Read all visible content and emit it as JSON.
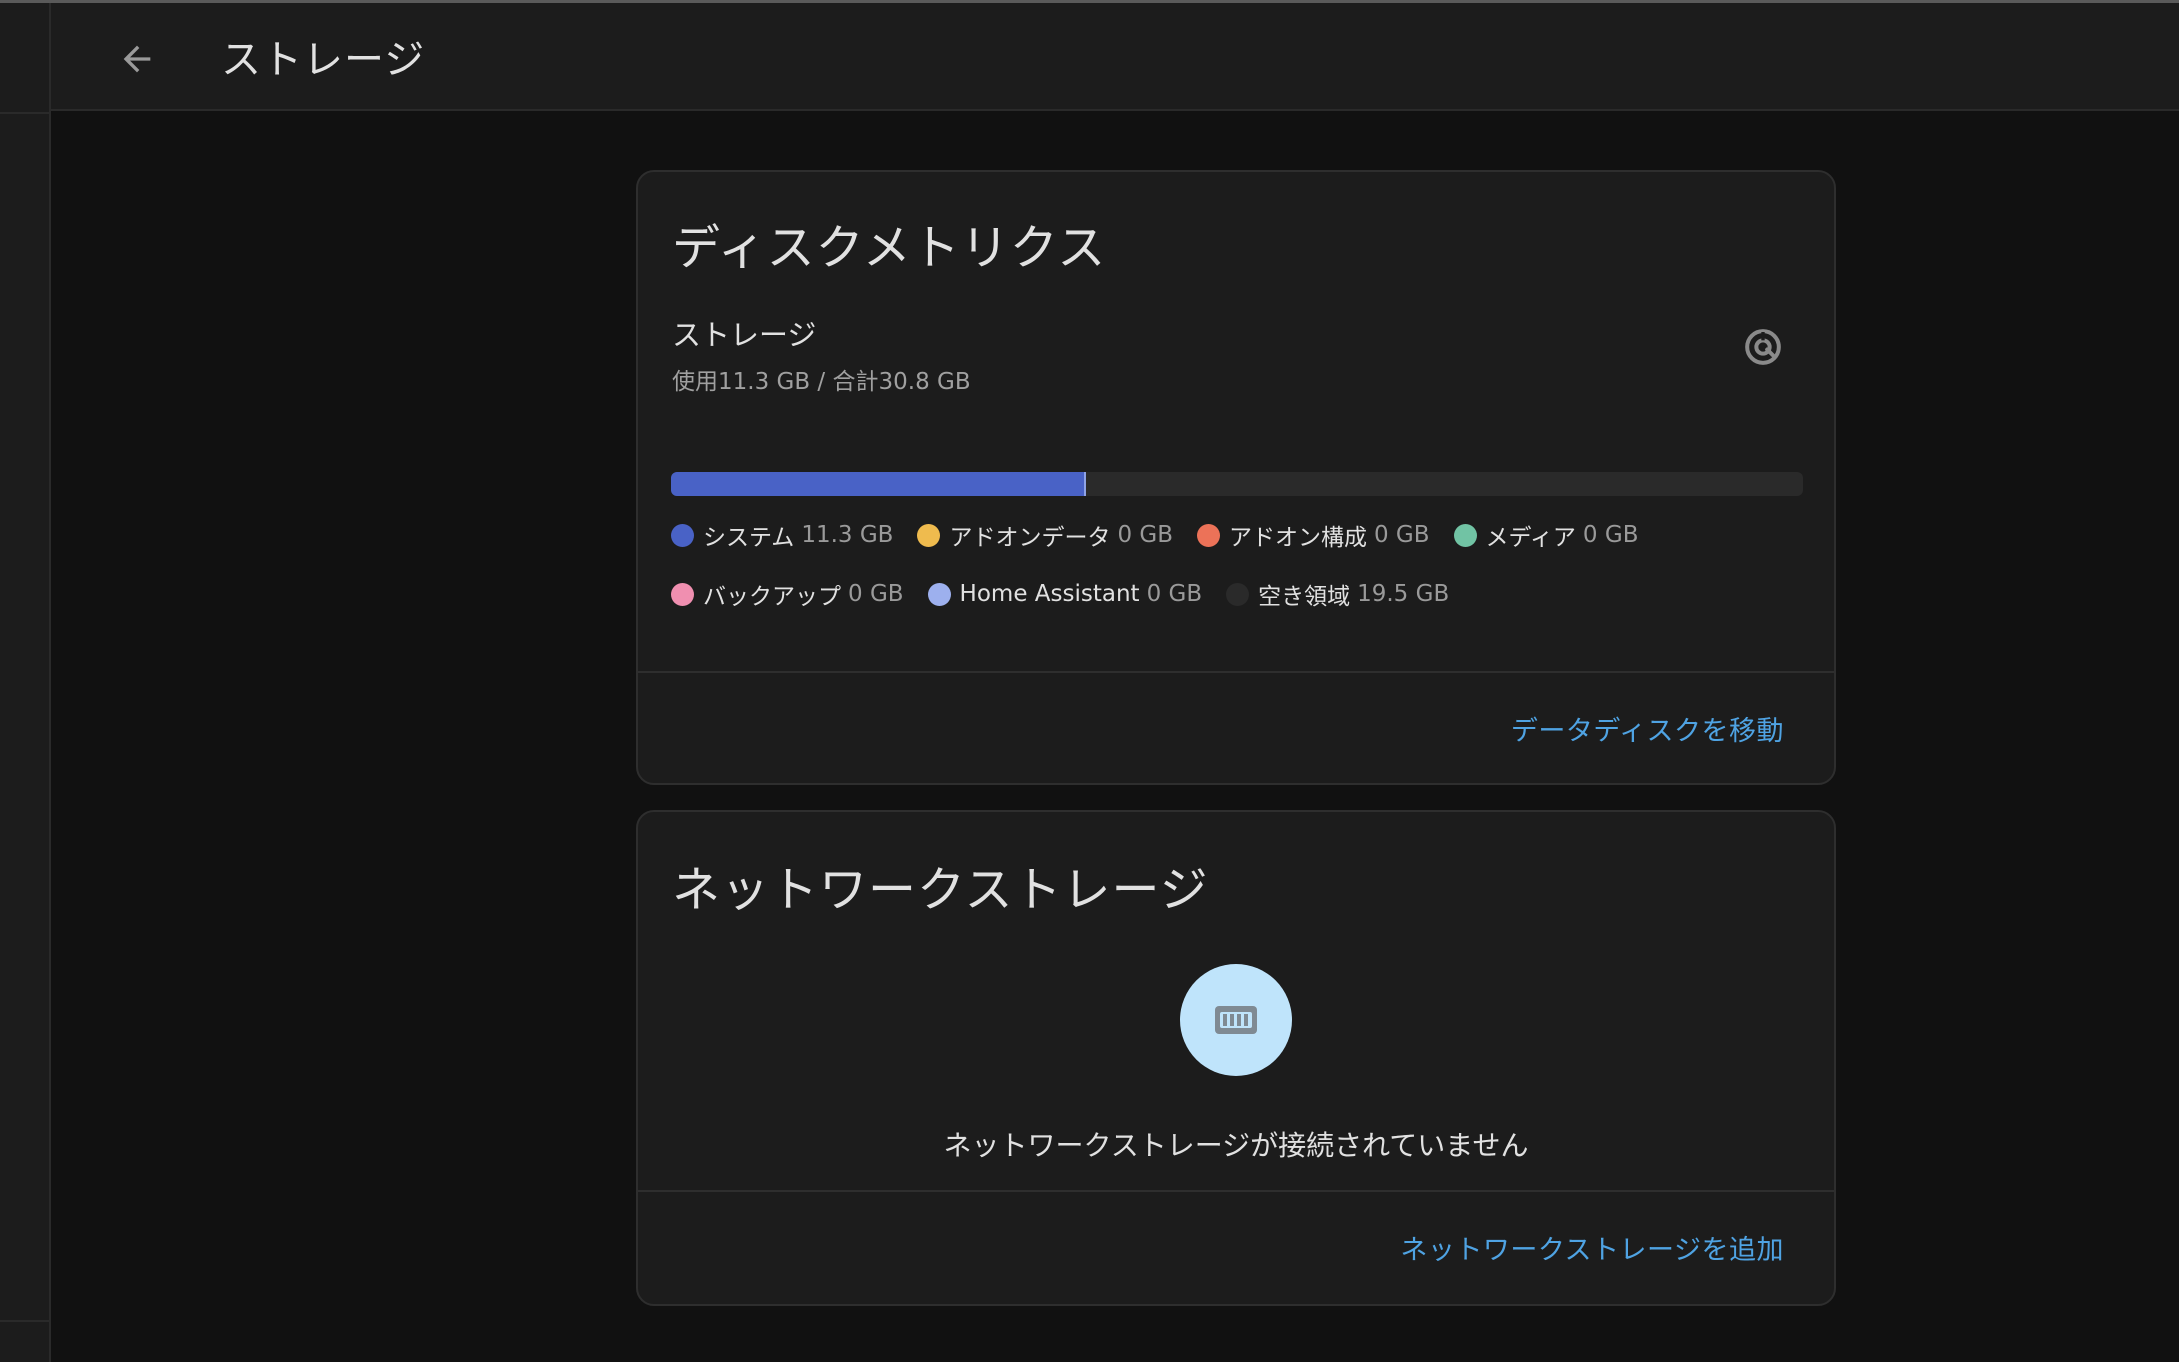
{
  "toolbar": {
    "back_icon": "arrow-left-icon",
    "title": "ストレージ"
  },
  "disk_metrics": {
    "title": "ディスクメトリクス",
    "storage_label": "ストレージ",
    "usage_text": "使用11.3 GB / 合計30.8 GB",
    "used_fraction": 0.367,
    "icon": "storage-disk-icon",
    "bar_color": "#4962c6",
    "legend": [
      {
        "name": "システム",
        "value": "11.3 GB",
        "color": "#4962c6"
      },
      {
        "name": "アドオンデータ",
        "value": "0 GB",
        "color": "#efbb4e"
      },
      {
        "name": "アドオン構成",
        "value": "0 GB",
        "color": "#ec7258"
      },
      {
        "name": "メディア",
        "value": "0 GB",
        "color": "#71c3a4"
      },
      {
        "name": "バックアップ",
        "value": "0 GB",
        "color": "#f08fb0"
      },
      {
        "name": "Home Assistant",
        "value": "0 GB",
        "color": "#9db0ee"
      },
      {
        "name": "空き領域",
        "value": "19.5 GB",
        "color": "#2a2a2a"
      }
    ],
    "action_label": "データディスクを移動"
  },
  "network_storage": {
    "title": "ネットワークストレージ",
    "empty_icon": "nas-icon",
    "empty_text": "ネットワークストレージが接続されていません",
    "action_label": "ネットワークストレージを追加",
    "accent_color": "#4fa3e3"
  }
}
